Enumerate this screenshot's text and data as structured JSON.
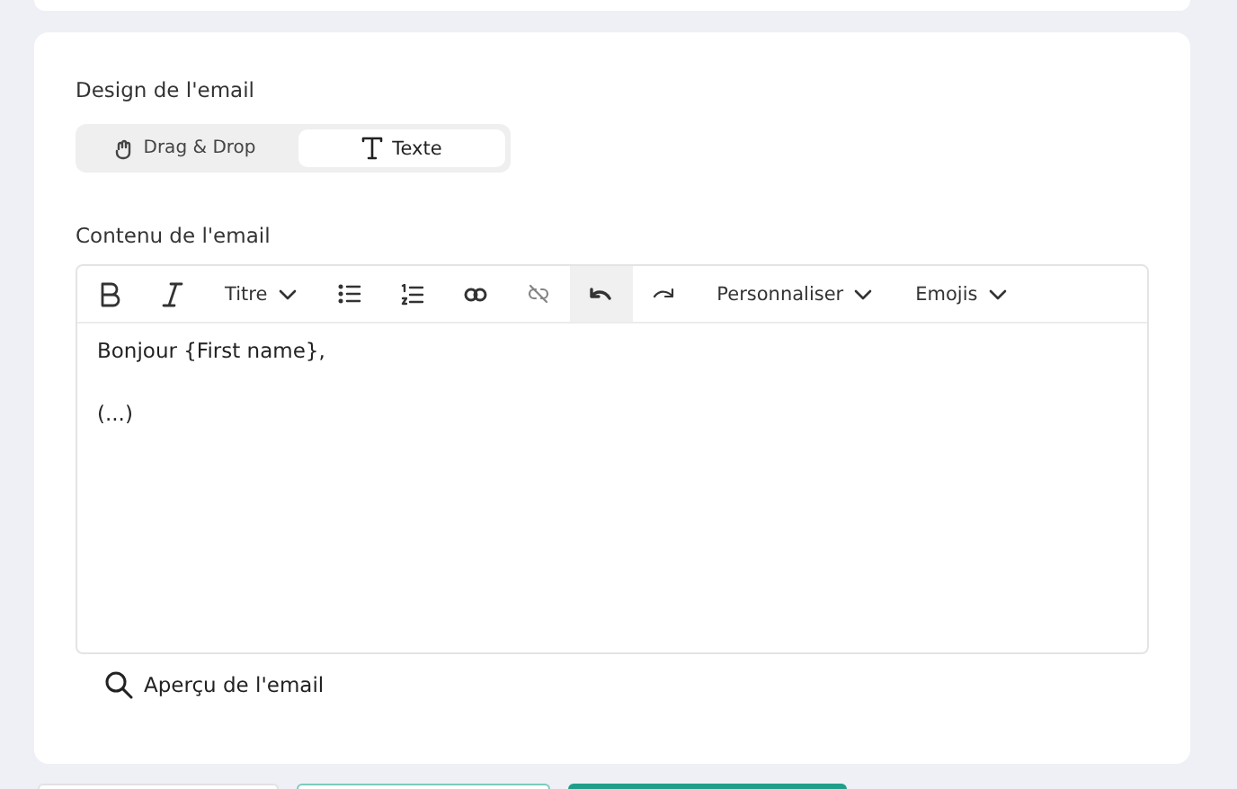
{
  "design": {
    "title": "Design de l'email",
    "modes": [
      {
        "label": "Drag & Drop",
        "selected": false
      },
      {
        "label": "Texte",
        "selected": true
      }
    ]
  },
  "content": {
    "title": "Contenu de l'email",
    "toolbar": [
      {
        "kind": "bold",
        "active": false
      },
      {
        "kind": "italic",
        "active": false
      },
      {
        "kind": "dropdown",
        "label": "Titre"
      },
      {
        "kind": "bullets",
        "active": false
      },
      {
        "kind": "numbers",
        "active": false
      },
      {
        "kind": "link",
        "active": false
      },
      {
        "kind": "unlink",
        "active": false
      },
      {
        "kind": "undo",
        "active": true
      },
      {
        "kind": "redo",
        "active": false
      },
      {
        "kind": "dropdown",
        "label": "Personnaliser"
      },
      {
        "kind": "dropdown",
        "label": "Emojis"
      }
    ],
    "body": [
      "Bonjour {First name},",
      "(...)"
    ],
    "preview": "Aperçu de l'email"
  },
  "footer_buttons": [
    {
      "kind": "plain"
    },
    {
      "kind": "outline"
    },
    {
      "kind": "primary"
    }
  ]
}
